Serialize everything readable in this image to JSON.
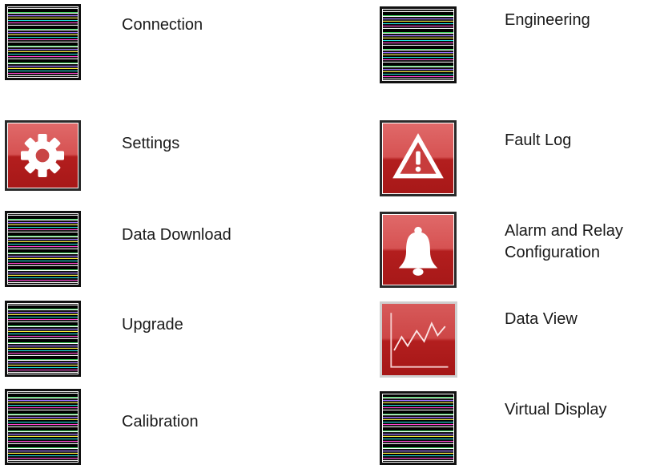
{
  "menu": {
    "left": [
      {
        "id": "connection",
        "label": "Connection",
        "icon": "connection-icon"
      },
      {
        "id": "settings",
        "label": "Settings",
        "icon": "gear-icon"
      },
      {
        "id": "data-download",
        "label": "Data Download",
        "icon": "data-download-icon"
      },
      {
        "id": "upgrade",
        "label": "Upgrade",
        "icon": "upgrade-icon"
      },
      {
        "id": "calibration",
        "label": "Calibration",
        "icon": "calibration-icon"
      }
    ],
    "right": [
      {
        "id": "engineering",
        "label": "Engineering",
        "icon": "engineering-icon"
      },
      {
        "id": "fault-log",
        "label": "Fault Log",
        "icon": "warning-triangle-icon"
      },
      {
        "id": "alarm-relay",
        "label_line1": "Alarm and Relay",
        "label_line2": "Configuration",
        "icon": "bell-icon"
      },
      {
        "id": "data-view",
        "label": "Data View",
        "icon": "line-chart-icon"
      },
      {
        "id": "virtual-display",
        "label": "Virtual Display",
        "icon": "virtual-display-icon"
      }
    ]
  },
  "colors": {
    "icon_red": "#c93a3a",
    "icon_red_dark": "#a51616",
    "icon_border": "#111111"
  }
}
